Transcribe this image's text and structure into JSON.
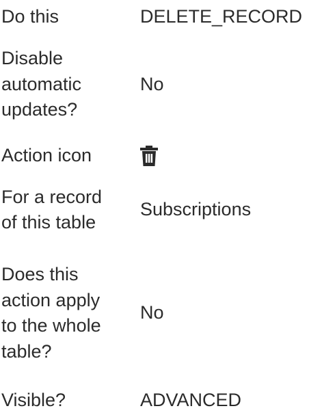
{
  "properties": [
    {
      "label": "Do this",
      "value": "DELETE_RECORD"
    },
    {
      "label": "Disable\nautomatic\nupdates?",
      "value": "No"
    },
    {
      "label": "Action icon",
      "icon": "trash-icon"
    },
    {
      "label": "For a record\nof this table",
      "value": "Subscriptions"
    },
    {
      "label": "Does this\naction apply\nto the whole\ntable?",
      "value": "No"
    },
    {
      "label": "Visible?",
      "value": "ADVANCED"
    }
  ]
}
